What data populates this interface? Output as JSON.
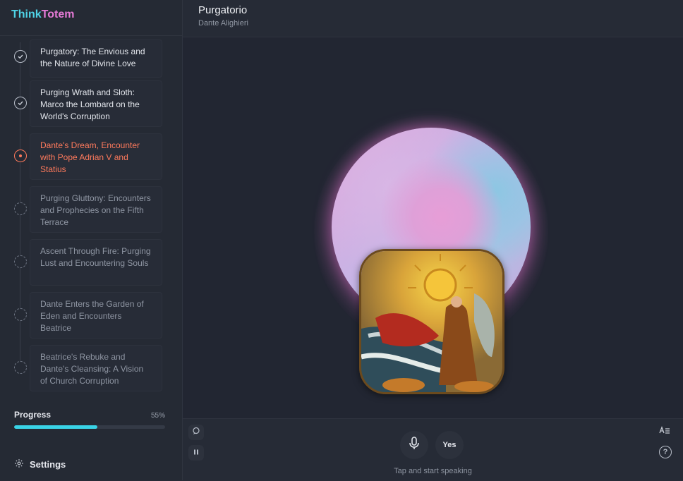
{
  "app": {
    "name_part1": "Think",
    "name_part2": "Totem"
  },
  "header": {
    "title": "Purgatorio",
    "author": "Dante Alighieri"
  },
  "chapters": [
    {
      "title": "Purgatory: The Envious and the Nature of Divine Love",
      "status": "done"
    },
    {
      "title": "Purging Wrath and Sloth: Marco the Lombard on the World's Corruption",
      "status": "done"
    },
    {
      "title": "Dante's Dream, Encounter with Pope Adrian V and Statius",
      "status": "active"
    },
    {
      "title": "Purging Gluttony: Encounters and Prophecies on the Fifth Terrace",
      "status": "todo"
    },
    {
      "title": "Ascent Through Fire: Purging Lust and Encountering Souls",
      "status": "todo"
    },
    {
      "title": "Dante Enters the Garden of Eden and Encounters Beatrice",
      "status": "todo"
    },
    {
      "title": "Beatrice's Rebuke and Dante's Cleansing: A Vision of Church Corruption",
      "status": "todo"
    }
  ],
  "progress": {
    "label": "Progress",
    "percent_label": "55%",
    "value": 0.55
  },
  "settings": {
    "label": "Settings"
  },
  "controls": {
    "yes_label": "Yes",
    "hint": "Tap and start speaking",
    "help_label": "?"
  },
  "colors": {
    "accent": "#ff7a5c",
    "progress": "#39d3e6",
    "logo_think": "#4fd3e6",
    "logo_totem": "#e57ad6"
  }
}
